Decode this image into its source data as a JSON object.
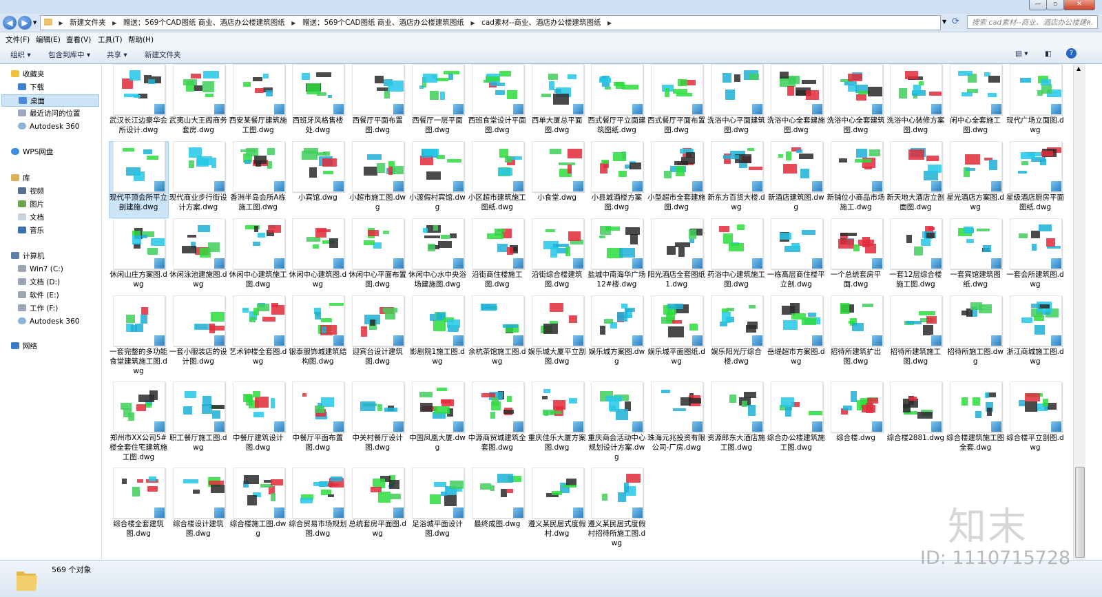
{
  "window": {
    "controls": [
      "—",
      "▫",
      "✕"
    ]
  },
  "address": {
    "back": "◀",
    "forward": "▶",
    "crumbs": [
      "新建文件夹",
      "赠送：569个CAD图纸 商业、酒店办公楼建筑图纸",
      "赠送：569个CAD图纸 商业、酒店办公楼建筑图纸",
      "cad素材--商业、酒店办公楼建筑图纸"
    ],
    "search_placeholder": "搜索 cad素材--商业、酒店办公楼建..."
  },
  "menu": [
    "文件(F)",
    "编辑(E)",
    "查看(V)",
    "工具(T)",
    "帮助(H)"
  ],
  "toolbar": {
    "organize": "组织 ▾",
    "include": "包含到库中 ▾",
    "share": "共享 ▾",
    "new_folder": "新建文件夹"
  },
  "sidebar": {
    "favorites": "收藏夹",
    "fav_items": [
      "下载",
      "桌面",
      "最近访问的位置",
      "Autodesk 360"
    ],
    "wps": "WPS网盘",
    "library": "库",
    "lib_items": [
      "视频",
      "图片",
      "文档",
      "音乐"
    ],
    "computer": "计算机",
    "drives": [
      "Win7 (C:)",
      "文档 (D:)",
      "软件 (E:)",
      "工作 (F:)",
      "Autodesk 360"
    ],
    "network": "网络"
  },
  "files": [
    "武汉长江边豪华会所设计.dwg",
    "武夷山大王阁商务套房.dwg",
    "西安某餐厅建筑施工图.dwg",
    "西班牙风格售楼处.dwg",
    "西餐厅平面布置图.dwg",
    "西餐厅一层平面图.dwg",
    "西班食堂设计平面图.dwg",
    "西单大厦总平面图.dwg",
    "西式餐厅平立面建筑图纸.dwg",
    "西式餐厅平面布置图.dwg",
    "洗浴中心平面建筑图.dwg",
    "洗浴中心全套建施图.dwg",
    "洗浴中心全套建筑图.dwg",
    "洗浴中心装修方案图.dwg",
    "闲中心全套施工图.dwg",
    "现代广场立面图.dwg",
    "现代平顶会所平立剖建施.dwg",
    "现代商业步行街设计方案.dwg",
    "香洲半岛会所A栋施工图.dwg",
    "小宾馆.dwg",
    "小超市施工图.dwg",
    "小渡假村宾馆.dwg",
    "小区超市建筑施工图纸.dwg",
    "小食堂.dwg",
    "小县城酒楼方案图.dwg",
    "小型超市全套建施图.dwg",
    "新东方百货大楼.dwg",
    "新酒店建筑图.dwg",
    "新铺位小商品市场施工.dwg",
    "新天地大酒店立剖面图.dwg",
    "星光酒店方案图.dwg",
    "星级酒店厨房平面图纸.dwg",
    "休闲山庄方案图.dwg",
    "休闲泳池建施图.dwg",
    "休闲中心建筑施工图.dwg",
    "休闲中心建筑图.dwg",
    "休闲中心平面布置图.dwg",
    "休闲中心水中央浴场建施图.dwg",
    "沿街商住楼施工图.dwg",
    "沿街综合楼建筑图.dwg",
    "盐城中南海华广场12#楼.dwg",
    "阳光酒店全套图纸1.dwg",
    "药浴中心建筑施工图.dwg",
    "一栋高层商住楼平立剖.dwg",
    "一个总统套房平面.dwg",
    "一套12层综合楼施工图.dwg",
    "一套宾馆建筑图纸.dwg",
    "一套会所建筑图.dwg",
    "一套完整的多功能食堂建筑施工图.dwg",
    "一套小服装店的设计图.dwg",
    "艺术钟楼全套图.dwg",
    "银泰服饰城建筑结构图.dwg",
    "迎宾台设计建筑图.dwg",
    "影剧院1施工图.dwg",
    "余杭茶馆施工图.dwg",
    "娱乐城大厦平立剖图.dwg",
    "娱乐城方案图.dwg",
    "娱乐城平面图纸.dwg",
    "娱乐阳光厅综合楼.dwg",
    "岳堤超市方案图.dwg",
    "招待所建筑扩出图.dwg",
    "招待所建筑施工图.dwg",
    "招待所施工图.dwg",
    "浙江商城施工图.dwg",
    "郑州市XX公司5#楼全套住宅建筑施工图.dwg",
    "职工餐厅施工图.dwg",
    "中餐厅建筑设计图.dwg",
    "中餐厅平面布置图.dwg",
    "中关村餐厅设计图.dwg",
    "中国凤凰大厦.dwg",
    "中源商贸城建筑全套图.dwg",
    "重庆佳乐大厦方案图.dwg",
    "重庆商会活动中心规划设计方案.dwg",
    "珠海元兆投资有限公司-厂房.dwg",
    "资源郎东大酒店施工图.dwg",
    "综合办公楼建筑施工图.dwg",
    "综合楼.dwg",
    "综合楼2881.dwg",
    "综合楼建筑施工图全套.dwg",
    "综合楼平立剖图.dwg",
    "综合楼全套建筑图.dwg",
    "综合楼设计建筑图.dwg",
    "综合楼施工图.dwg",
    "综合贸易市场规划图.dwg",
    "总统套房平面图.dwg",
    "足浴城平面设计图.dwg",
    "最终成图.dwg",
    "遵义某民居式度假村.dwg",
    "遵义某民居式度假村招待所施工图.dwg"
  ],
  "status": {
    "count": "569 个对象"
  },
  "watermark": {
    "logo": "知末",
    "id": "ID: 1110715728"
  },
  "colors": {
    "title_bg": "#cfe0f3",
    "selected": "#cce4f7",
    "cad_green": "#2bdc3c",
    "cad_cyan": "#23c8e6",
    "cad_red": "#e22a3a"
  }
}
